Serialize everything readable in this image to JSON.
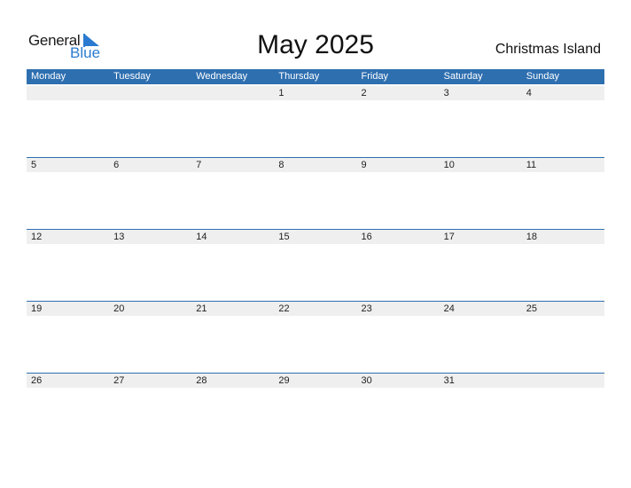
{
  "logo": {
    "word1": "General",
    "word2": "Blue"
  },
  "title": "May 2025",
  "country": "Christmas Island",
  "colors": {
    "accent": "#2e6fb0",
    "logo_blue": "#2a7bd0",
    "strip": "#efefef"
  },
  "weekdays": [
    "Monday",
    "Tuesday",
    "Wednesday",
    "Thursday",
    "Friday",
    "Saturday",
    "Sunday"
  ],
  "weeks": [
    [
      "",
      "",
      "",
      "1",
      "2",
      "3",
      "4"
    ],
    [
      "5",
      "6",
      "7",
      "8",
      "9",
      "10",
      "11"
    ],
    [
      "12",
      "13",
      "14",
      "15",
      "16",
      "17",
      "18"
    ],
    [
      "19",
      "20",
      "21",
      "22",
      "23",
      "24",
      "25"
    ],
    [
      "26",
      "27",
      "28",
      "29",
      "30",
      "31",
      ""
    ]
  ]
}
